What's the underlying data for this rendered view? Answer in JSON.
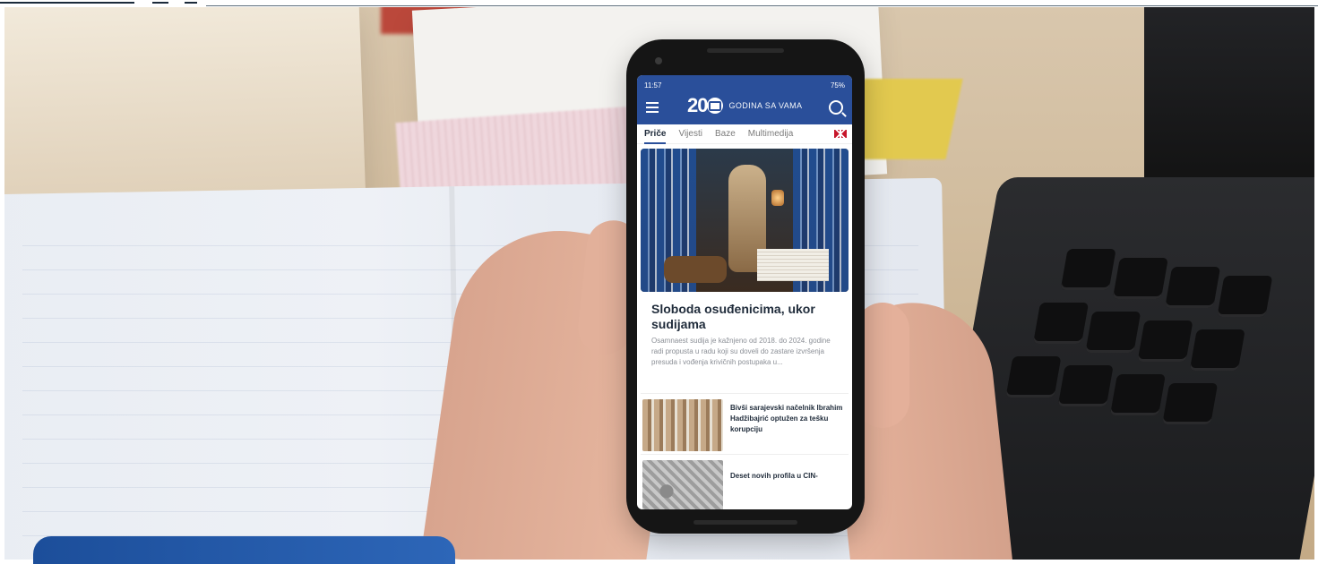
{
  "phone": {
    "status_time": "11:57",
    "status_battery": "75%",
    "brand_number": "20",
    "brand_tagline": "GODINA SA VAMA",
    "tabs": [
      {
        "label": "Priče",
        "active": true
      },
      {
        "label": "Vijesti",
        "active": false
      },
      {
        "label": "Baze",
        "active": false
      },
      {
        "label": "Multimedija",
        "active": false
      }
    ],
    "icons": {
      "menu": "menu-icon",
      "search": "search-icon",
      "language": "uk-flag-icon"
    },
    "feature": {
      "title": "Sloboda osuđenicima, ukor sudijama",
      "excerpt": "Osamnaest sudija je kažnjeno od 2018. do 2024. godine radi propusta u radu koji su doveli do zastare izvršenja presuda i vođenja krivičnih postupaka u..."
    },
    "list": [
      {
        "title": "Bivši sarajevski načelnik Ibrahim Hadžibajrić optužen za tešku korupciju"
      },
      {
        "title": "Deset novih profila u CIN-"
      }
    ]
  },
  "colors": {
    "appbar": "#2a4f9a",
    "tab_active_underline": "#2a4f9a",
    "cta": "#1c4e9a"
  }
}
